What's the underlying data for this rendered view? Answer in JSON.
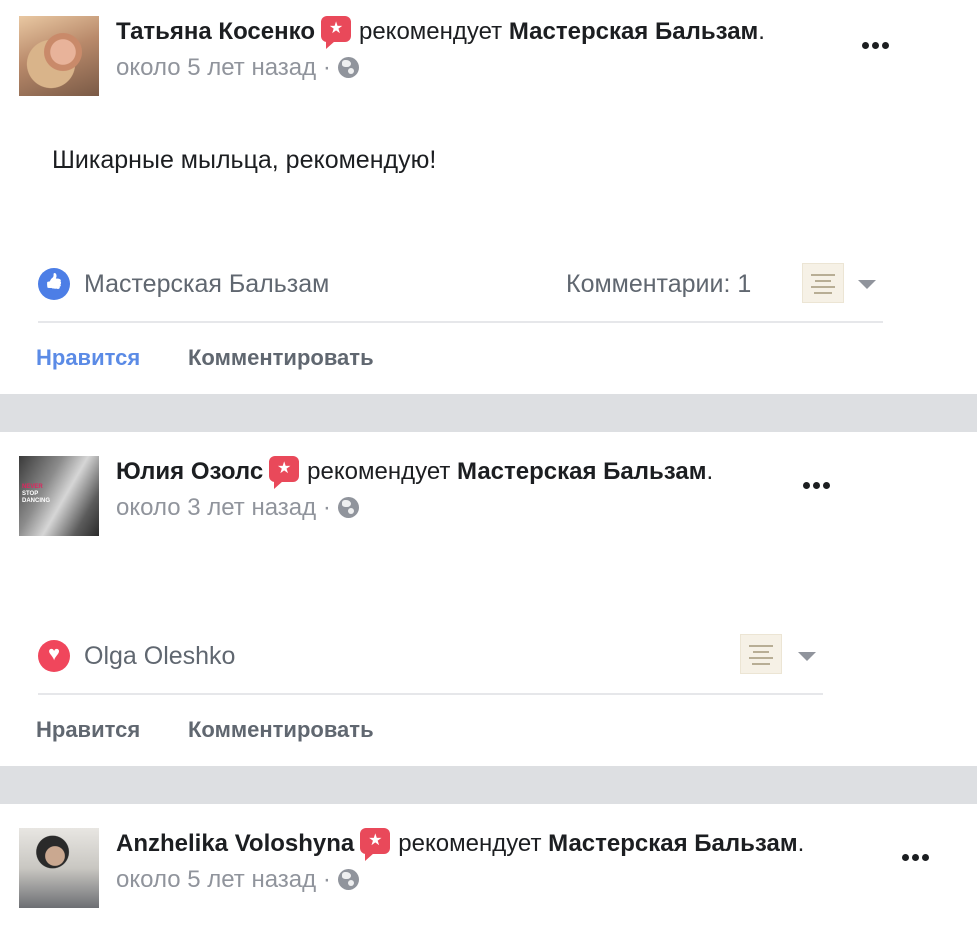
{
  "posts": [
    {
      "author": "Татьяна Косенко",
      "verb": "рекомендует",
      "page": "Мастерская Бальзам",
      "time": "около 5 лет назад",
      "text": "Шикарные мыльца, рекомендую!",
      "reaction_type": "like-icon",
      "reactor": "Мастерская Бальзам",
      "comments": "Комментарии: 1",
      "like_label": "Нравится",
      "comment_label": "Комментировать",
      "liked": true
    },
    {
      "author": "Юлия Озолс",
      "verb": "рекомендует",
      "page": "Мастерская Бальзам",
      "time": "около 3 лет назад",
      "text": "",
      "avatar_text": [
        "NEVER",
        "STOP",
        "DANCING"
      ],
      "reaction_type": "heart-icon",
      "reactor": "Olga Oleshko",
      "comments": "",
      "like_label": "Нравится",
      "comment_label": "Комментировать",
      "liked": false
    },
    {
      "author": "Anzhelika Voloshyna",
      "verb": "рекомендует",
      "page": "Мастерская Бальзам",
      "time": "около 5 лет назад"
    }
  ],
  "punctuation": ".",
  "time_sep": "·",
  "colors": {
    "recommend_badge": "#e9495a",
    "like_active": "#5b8be6",
    "like_reaction": "#4c7ee6",
    "love_reaction": "#f0465c",
    "separator": "#dddfe2",
    "muted_text": "#90949c"
  }
}
